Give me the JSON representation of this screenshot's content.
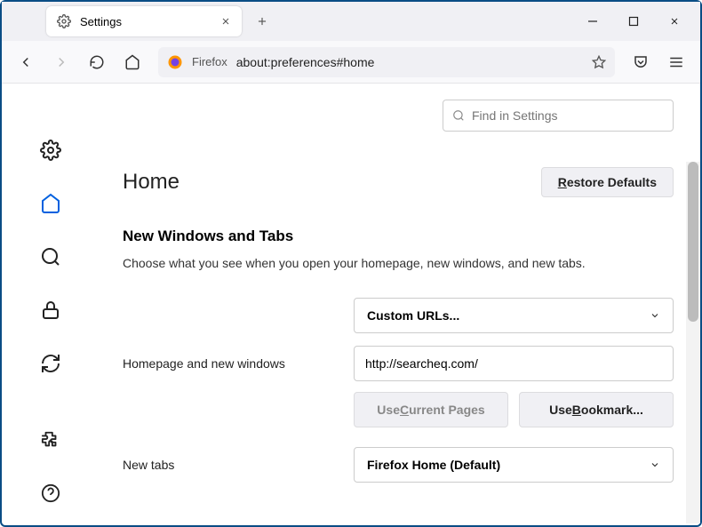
{
  "tab": {
    "title": "Settings"
  },
  "urlbar": {
    "prefix": "Firefox",
    "url": "about:preferences#home"
  },
  "search": {
    "placeholder": "Find in Settings"
  },
  "page": {
    "heading": "Home",
    "restore_label_pre": "R",
    "restore_label_rest": "estore Defaults"
  },
  "section": {
    "title": "New Windows and Tabs",
    "desc": "Choose what you see when you open your homepage, new windows, and new tabs."
  },
  "homepage": {
    "label": "Homepage and new windows",
    "dropdown": "Custom URLs...",
    "value": "http://searcheq.com/",
    "use_current_pre": "Use ",
    "use_current_u": "C",
    "use_current_rest": "urrent Pages",
    "use_bookmark_pre": "Use ",
    "use_bookmark_u": "B",
    "use_bookmark_rest": "ookmark..."
  },
  "newtabs": {
    "label": "New tabs",
    "dropdown": "Firefox Home (Default)"
  }
}
